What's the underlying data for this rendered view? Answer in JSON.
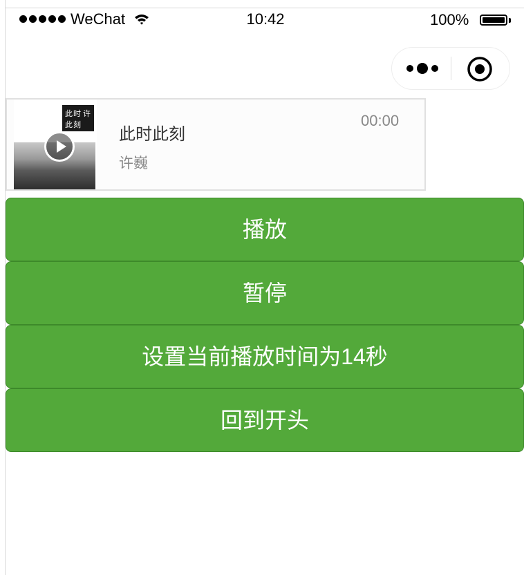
{
  "status_bar": {
    "carrier": "WeChat",
    "time": "10:42",
    "battery": "100%"
  },
  "audio": {
    "name": "此时此刻",
    "author": "许巍",
    "current_time": "00:00",
    "poster_stamp": [
      "此",
      "时",
      "许",
      "此",
      "刻"
    ]
  },
  "buttons": {
    "play": "播放",
    "pause": "暂停",
    "seek": "设置当前播放时间为14秒",
    "restart": "回到开头"
  },
  "colors": {
    "button_green": "#53a93a",
    "text_gray": "#888888"
  },
  "icons": [
    "signal-icon",
    "wifi-icon",
    "battery-icon",
    "more-icon",
    "target-icon",
    "play-icon"
  ]
}
